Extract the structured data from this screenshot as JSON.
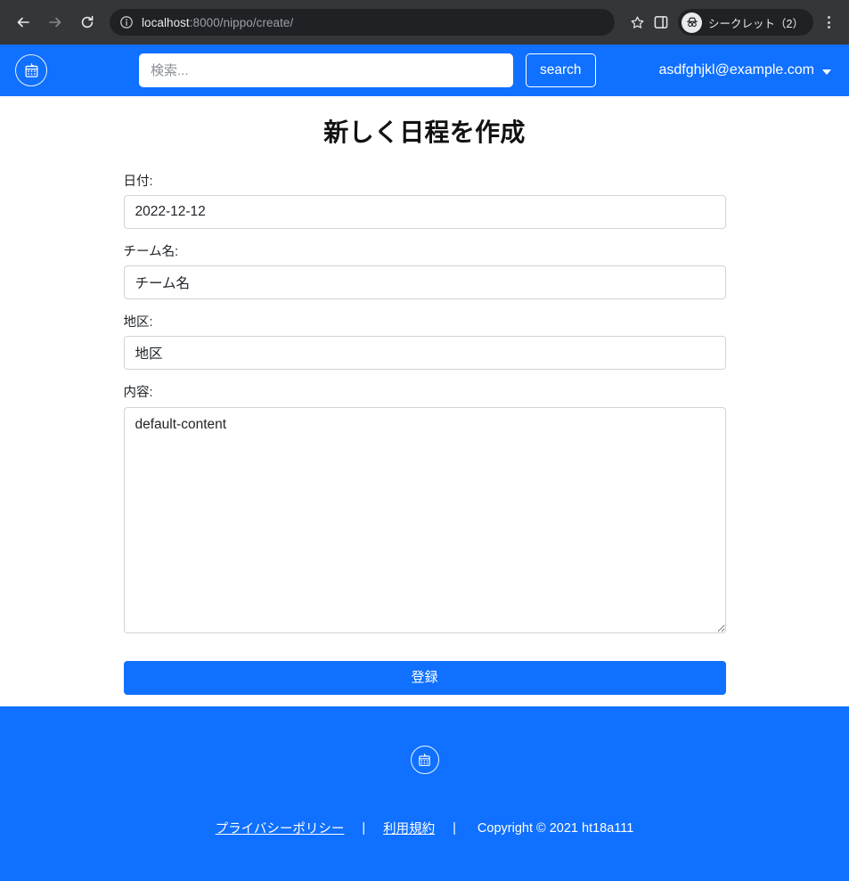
{
  "browser": {
    "back_icon": "back-arrow-icon",
    "forward_icon": "forward-arrow-icon",
    "reload_icon": "reload-icon",
    "site_info_icon": "site-info-icon",
    "url_host": "localhost",
    "url_rest": ":8000/nippo/create/",
    "bookmark_icon": "star-icon",
    "side_panel_icon": "side-panel-icon",
    "incognito_label": "シークレット（2）",
    "incognito_icon": "incognito-hat-icon",
    "menu_icon": "three-dot-menu-icon"
  },
  "header": {
    "logo_icon": "calendar-badge-logo-icon",
    "search_placeholder": "検索...",
    "search_value": "",
    "search_button_label": "search",
    "user_email": "asdfghjkl@example.com",
    "user_caret_icon": "chevron-down-icon",
    "background_color": "#1070ff"
  },
  "main": {
    "title": "新しく日程を作成",
    "fields": [
      {
        "label": "日付:",
        "value": "2022-12-12",
        "name": "date"
      },
      {
        "label": "チーム名:",
        "value": "チーム名",
        "name": "team"
      },
      {
        "label": "地区:",
        "value": "地区",
        "name": "area"
      },
      {
        "label": "内容:",
        "value": "default-content",
        "name": "content"
      }
    ],
    "submit_label": "登録",
    "submit_color": "#1070ff"
  },
  "footer": {
    "logo_icon": "calendar-badge-logo-icon",
    "privacy_link": "プライバシーポリシー",
    "terms_link": "利用規約",
    "separator": "|",
    "copyright": "Copyright © 2021 ht18a111",
    "background_color": "#1070ff"
  }
}
